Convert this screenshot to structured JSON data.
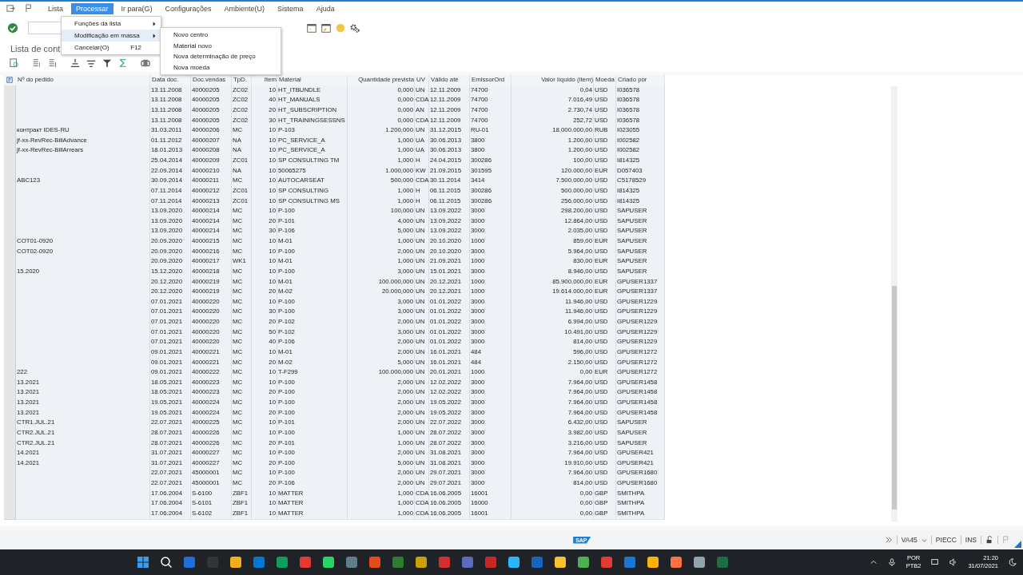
{
  "menu": [
    {
      "label": "Lista",
      "selected": false
    },
    {
      "label": "Processar",
      "selected": true
    },
    {
      "label": "Ir para(G)",
      "selected": false
    },
    {
      "label": "Configurações",
      "selected": false
    },
    {
      "label": "Ambiente(U)",
      "selected": false
    },
    {
      "label": "Sistema",
      "selected": false
    },
    {
      "label": "Ajuda",
      "selected": false
    }
  ],
  "dropdown": [
    {
      "label": "Funções da lista",
      "submenu": true,
      "selected": false
    },
    {
      "label": "Modificação em massa",
      "submenu": true,
      "selected": true
    },
    {
      "label": "Cancelar(O)",
      "shortcut": "F12",
      "submenu": false,
      "selected": false
    }
  ],
  "submenu": [
    "Novo centro",
    "Material novo",
    "Nova determinação de preço",
    "Nova moeda"
  ],
  "page_title": "Lista de cont",
  "table": {
    "columns": [
      "Nº do pedido",
      "Data doc.",
      "Doc.vendas",
      "TpD.",
      "Item",
      "Material",
      "Quantidade prevista",
      "UV",
      "Válido até",
      "EmissorOrd",
      "Valor líquido (item)",
      "Moeda",
      "Criado por"
    ],
    "rows": [
      [
        "",
        "13.11.2008",
        "40000205",
        "ZC02",
        "10",
        "HT_ITBUNDLE",
        "0,000",
        "UN",
        "12.11.2009",
        "74700",
        "0,04",
        "USD",
        "I036578"
      ],
      [
        "",
        "13.11.2008",
        "40000205",
        "ZC02",
        "40",
        "HT_MANUALS",
        "0,000",
        "CDA",
        "12.11.2009",
        "74700",
        "7.016,49",
        "USD",
        "I036578"
      ],
      [
        "",
        "13.11.2008",
        "40000205",
        "ZC02",
        "20",
        "HT_SUBSCRIPTION",
        "0,000",
        "AN",
        "12.11.2009",
        "74700",
        "2.730,74",
        "USD",
        "I036578"
      ],
      [
        "",
        "13.11.2008",
        "40000205",
        "ZC02",
        "30",
        "HT_TRAININGSESSNS",
        "0,000",
        "CDA",
        "12.11.2009",
        "74700",
        "252,72",
        "USD",
        "I036578"
      ],
      [
        "контракт IDES-RU",
        "31.03.2011",
        "40000206",
        "MC",
        "10",
        "P-103",
        "1.200,000",
        "UN",
        "31.12.2015",
        "RU-01",
        "18.000.000,00",
        "RUB",
        "I023055"
      ],
      [
        "jf-xx-RevRec-BillAdvance",
        "01.11.2012",
        "40000207",
        "NA",
        "10",
        "PC_SERVICE_A",
        "1,000",
        "UA",
        "30.06.2013",
        "3800",
        "1.200,00",
        "USD",
        "I002582"
      ],
      [
        "jf-xx-RevRec-BillArrears",
        "18.01.2013",
        "40000208",
        "NA",
        "10",
        "PC_SERVICE_A",
        "1,000",
        "UA",
        "30.06.2013",
        "3800",
        "1.200,00",
        "USD",
        "I002582"
      ],
      [
        "",
        "25.04.2014",
        "40000209",
        "ZC01",
        "10",
        "SP CONSULTING TM",
        "1,000",
        "H",
        "24.04.2015",
        "300286",
        "100,00",
        "USD",
        "I814325"
      ],
      [
        "",
        "22.09.2014",
        "40000210",
        "NA",
        "10",
        "50065275",
        "1.000,000",
        "KW",
        "21.09.2015",
        "301595",
        "120.000,00",
        "EUR",
        "D057403"
      ],
      [
        "ABC123",
        "30.09.2014",
        "40000211",
        "MC",
        "10",
        "AUTOCARSEAT",
        "500,000",
        "CDA",
        "30.11.2014",
        "3414",
        "7.500.000,00",
        "USD",
        "C5178529"
      ],
      [
        "",
        "07.11.2014",
        "40000212",
        "ZC01",
        "10",
        "SP CONSULTING",
        "1,000",
        "H",
        "06.11.2015",
        "300286",
        "500.000,00",
        "USD",
        "I814325"
      ],
      [
        "",
        "07.11.2014",
        "40000213",
        "ZC01",
        "10",
        "SP CONSULTING MS",
        "1,000",
        "H",
        "06.11.2015",
        "300286",
        "256.000,00",
        "USD",
        "I814325"
      ],
      [
        "",
        "13.09.2020",
        "40000214",
        "MC",
        "10",
        "P-100",
        "100,000",
        "UN",
        "13.09.2022",
        "3000",
        "298.200,00",
        "USD",
        "SAPUSER"
      ],
      [
        "",
        "13.09.2020",
        "40000214",
        "MC",
        "20",
        "P-101",
        "4,000",
        "UN",
        "13.09.2022",
        "3000",
        "12.864,00",
        "USD",
        "SAPUSER"
      ],
      [
        "",
        "13.09.2020",
        "40000214",
        "MC",
        "30",
        "P-106",
        "5,000",
        "UN",
        "13.09.2022",
        "3000",
        "2.035,00",
        "USD",
        "SAPUSER"
      ],
      [
        "COT01-0920",
        "20.09.2020",
        "40000215",
        "MC",
        "10",
        "M-01",
        "1,000",
        "UN",
        "20.10.2020",
        "1000",
        "859,00",
        "EUR",
        "SAPUSER"
      ],
      [
        "COT02-0920",
        "20.09.2020",
        "40000216",
        "MC",
        "10",
        "P-100",
        "2,000",
        "UN",
        "20.10.2020",
        "3000",
        "5.964,00",
        "USD",
        "SAPUSER"
      ],
      [
        "",
        "20.09.2020",
        "40000217",
        "WK1",
        "10",
        "M-01",
        "1,000",
        "UN",
        "21.09.2021",
        "1000",
        "830,00",
        "EUR",
        "SAPUSER"
      ],
      [
        "15.2020",
        "15.12.2020",
        "40000218",
        "MC",
        "10",
        "P-100",
        "3,000",
        "UN",
        "15.01.2021",
        "3000",
        "8.946,00",
        "USD",
        "SAPUSER"
      ],
      [
        "",
        "20.12.2020",
        "40000219",
        "MC",
        "10",
        "M-01",
        "100.000,000",
        "UN",
        "20.12.2021",
        "1000",
        "85.900.000,00",
        "EUR",
        "GPUSER1337"
      ],
      [
        "",
        "20.12.2020",
        "40000219",
        "MC",
        "20",
        "M-02",
        "20.000,000",
        "UN",
        "20.12.2021",
        "1000",
        "19.614.000,00",
        "EUR",
        "GPUSER1337"
      ],
      [
        "",
        "07.01.2021",
        "40000220",
        "MC",
        "10",
        "P-100",
        "3,000",
        "UN",
        "01.01.2022",
        "3000",
        "11.946,00",
        "USD",
        "GPUSER1229"
      ],
      [
        "",
        "07.01.2021",
        "40000220",
        "MC",
        "30",
        "P-100",
        "3,000",
        "UN",
        "01.01.2022",
        "3000",
        "11.946,00",
        "USD",
        "GPUSER1229"
      ],
      [
        "",
        "07.01.2021",
        "40000220",
        "MC",
        "20",
        "P-102",
        "2,000",
        "UN",
        "01.01.2022",
        "3000",
        "6.994,00",
        "USD",
        "GPUSER1229"
      ],
      [
        "",
        "07.01.2021",
        "40000220",
        "MC",
        "50",
        "P-102",
        "3,000",
        "UN",
        "01.01.2022",
        "3000",
        "10.491,00",
        "USD",
        "GPUSER1229"
      ],
      [
        "",
        "07.01.2021",
        "40000220",
        "MC",
        "40",
        "P-106",
        "2,000",
        "UN",
        "01.01.2022",
        "3000",
        "814,00",
        "USD",
        "GPUSER1229"
      ],
      [
        "",
        "09.01.2021",
        "40000221",
        "MC",
        "10",
        "M-01",
        "2,000",
        "UN",
        "16.01.2021",
        "484",
        "596,00",
        "USD",
        "GPUSER1272"
      ],
      [
        "",
        "09.01.2021",
        "40000221",
        "MC",
        "20",
        "M-02",
        "5,000",
        "UN",
        "16.01.2021",
        "484",
        "2.150,00",
        "USD",
        "GPUSER1272"
      ],
      [
        "222",
        "09.01.2021",
        "40000222",
        "MC",
        "10",
        "T-F299",
        "100.000,000",
        "UN",
        "20.01.2021",
        "1000",
        "0,00",
        "EUR",
        "GPUSER1272"
      ],
      [
        "13.2021",
        "18.05.2021",
        "40000223",
        "MC",
        "10",
        "P-100",
        "2,000",
        "UN",
        "12.02.2022",
        "3000",
        "7.964,00",
        "USD",
        "GPUSER1458"
      ],
      [
        "13.2021",
        "18.05.2021",
        "40000223",
        "MC",
        "20",
        "P-100",
        "2,000",
        "UN",
        "12.02.2022",
        "3000",
        "7.964,00",
        "USD",
        "GPUSER1458"
      ],
      [
        "13.2021",
        "19.05.2021",
        "40000224",
        "MC",
        "10",
        "P-100",
        "2,000",
        "UN",
        "19.05.2022",
        "3000",
        "7.964,00",
        "USD",
        "GPUSER1458"
      ],
      [
        "13.2021",
        "19.05.2021",
        "40000224",
        "MC",
        "20",
        "P-100",
        "2,000",
        "UN",
        "19.05.2022",
        "3000",
        "7.964,00",
        "USD",
        "GPUSER1458"
      ],
      [
        "CTR1.JUL.21",
        "22.07.2021",
        "40000225",
        "MC",
        "10",
        "P-101",
        "2,000",
        "UN",
        "22.07.2022",
        "3000",
        "6.432,00",
        "USD",
        "SAPUSER"
      ],
      [
        "CTR2.JUL.21",
        "28.07.2021",
        "40000226",
        "MC",
        "10",
        "P-100",
        "1,000",
        "UN",
        "28.07.2022",
        "3000",
        "3.982,00",
        "USD",
        "SAPUSER"
      ],
      [
        "CTR2.JUL.21",
        "28.07.2021",
        "40000226",
        "MC",
        "20",
        "P-101",
        "1,000",
        "UN",
        "28.07.2022",
        "3000",
        "3.216,00",
        "USD",
        "SAPUSER"
      ],
      [
        "14.2021",
        "31.07.2021",
        "40000227",
        "MC",
        "10",
        "P-100",
        "2,000",
        "UN",
        "31.08.2021",
        "3000",
        "7.964,00",
        "USD",
        "GPUSER421"
      ],
      [
        "14.2021",
        "31.07.2021",
        "40000227",
        "MC",
        "20",
        "P-100",
        "5,000",
        "UN",
        "31.08.2021",
        "3000",
        "19.910,00",
        "USD",
        "GPUSER421"
      ],
      [
        "",
        "22.07.2021",
        "45000001",
        "MC",
        "10",
        "P-100",
        "2,000",
        "UN",
        "29.07.2021",
        "3000",
        "7.964,00",
        "USD",
        "GPUSER1680"
      ],
      [
        "",
        "22.07.2021",
        "45000001",
        "MC",
        "20",
        "P-106",
        "2,000",
        "UN",
        "29.07.2021",
        "3000",
        "814,00",
        "USD",
        "GPUSER1680"
      ],
      [
        "",
        "17.06.2004",
        "S-6100",
        "ZBF1",
        "10",
        "MATTER",
        "1,000",
        "CDA",
        "16.06.2005",
        "16001",
        "0,00",
        "GBP",
        "SMITHPA"
      ],
      [
        "",
        "17.06.2004",
        "S-6101",
        "ZBF1",
        "10",
        "MATTER",
        "1,000",
        "CDA",
        "16.06.2005",
        "16000",
        "0,00",
        "GBP",
        "SMITHPA"
      ],
      [
        "",
        "17.06.2004",
        "S-6102",
        "ZBF1",
        "10",
        "MATTER",
        "1,000",
        "CDA",
        "16.06.2005",
        "16001",
        "0,00",
        "GBP",
        "SMITHPA"
      ]
    ]
  },
  "status_bar": {
    "logo": "SAP",
    "transaction": "VA45",
    "server": "PIECC",
    "mode": "INS"
  },
  "taskbar": {
    "language": "POR",
    "layout": "PTB2",
    "time": "21:20",
    "date": "31/07/2021"
  }
}
